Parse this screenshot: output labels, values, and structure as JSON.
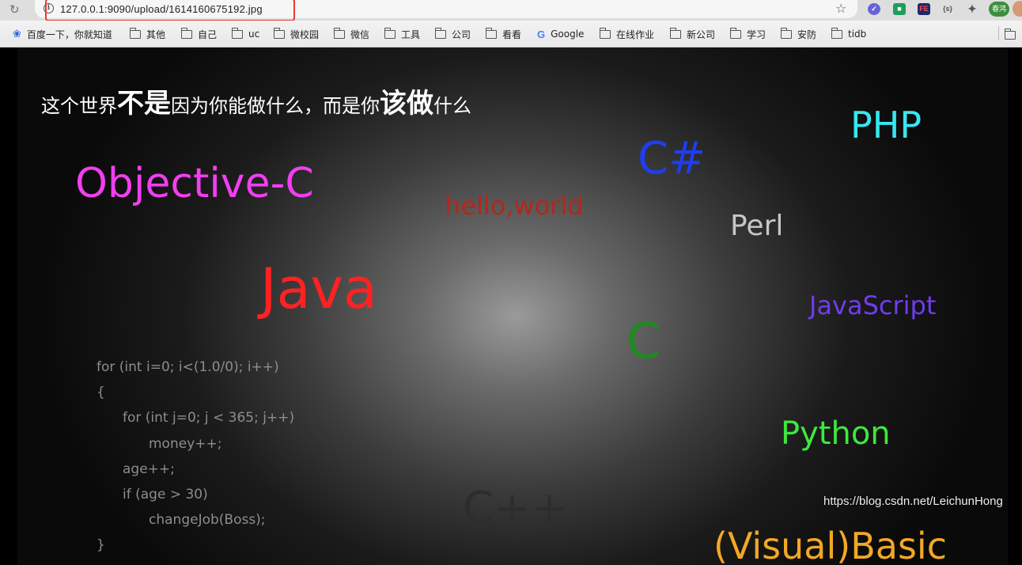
{
  "browser": {
    "url": "127.0.0.1:9090/upload/1614160675192.jpg",
    "reload_icon": "reload-icon",
    "info_icon": "info-icon",
    "star_icon": "star-icon",
    "extensions": {
      "fe_label": "FE",
      "s_label": "{s}",
      "profile_label": "春鸿"
    }
  },
  "bookmarks": [
    {
      "label": "百度一下，你就知道",
      "icon": "baidu-paw-icon"
    },
    {
      "label": "其他",
      "icon": "folder-icon"
    },
    {
      "label": "自己",
      "icon": "folder-icon"
    },
    {
      "label": "uc",
      "icon": "folder-icon"
    },
    {
      "label": "微校园",
      "icon": "folder-icon"
    },
    {
      "label": "微信",
      "icon": "folder-icon"
    },
    {
      "label": "工具",
      "icon": "folder-icon"
    },
    {
      "label": "公司",
      "icon": "folder-icon"
    },
    {
      "label": "看看",
      "icon": "folder-icon"
    },
    {
      "label": "Google",
      "icon": "google-icon"
    },
    {
      "label": "在线作业",
      "icon": "folder-icon"
    },
    {
      "label": "新公司",
      "icon": "folder-icon"
    },
    {
      "label": "学习",
      "icon": "folder-icon"
    },
    {
      "label": "安防",
      "icon": "folder-icon"
    },
    {
      "label": "tidb",
      "icon": "folder-icon"
    }
  ],
  "image": {
    "motto": {
      "part1": "这个世界",
      "part2": "不是",
      "part3": "因为你能做什么，而是你",
      "part4": "该做",
      "part5": "什么"
    },
    "words": {
      "php": "PHP",
      "csharp": "C#",
      "objc": "Objective-C",
      "hello": "hello,world",
      "perl": "Perl",
      "java": "Java",
      "javascript": "JavaScript",
      "c": "C",
      "python": "Python",
      "cpp": "C++",
      "vb": "(Visual)Basic"
    },
    "code_lines": [
      "for (int i=0; i<(1.0/0); i++)",
      "{",
      "for (int j=0; j < 365; j++)",
      "money++;",
      "age++;",
      "if (age > 30)",
      "changeJob(Boss);",
      "}"
    ],
    "colors": {
      "php": "#35e8f0",
      "csharp": "#1f3df0",
      "objc": "#f23ef0",
      "hello": "#b4271c",
      "perl": "#c6c6c6",
      "java": "#ff2222",
      "javascript": "#6f3cf0",
      "c": "#1f8a1f",
      "python": "#3ee83e",
      "cpp": "#2d2d2d",
      "vb": "#f2a826"
    }
  },
  "watermark": "https://blog.csdn.net/LeichunHong"
}
